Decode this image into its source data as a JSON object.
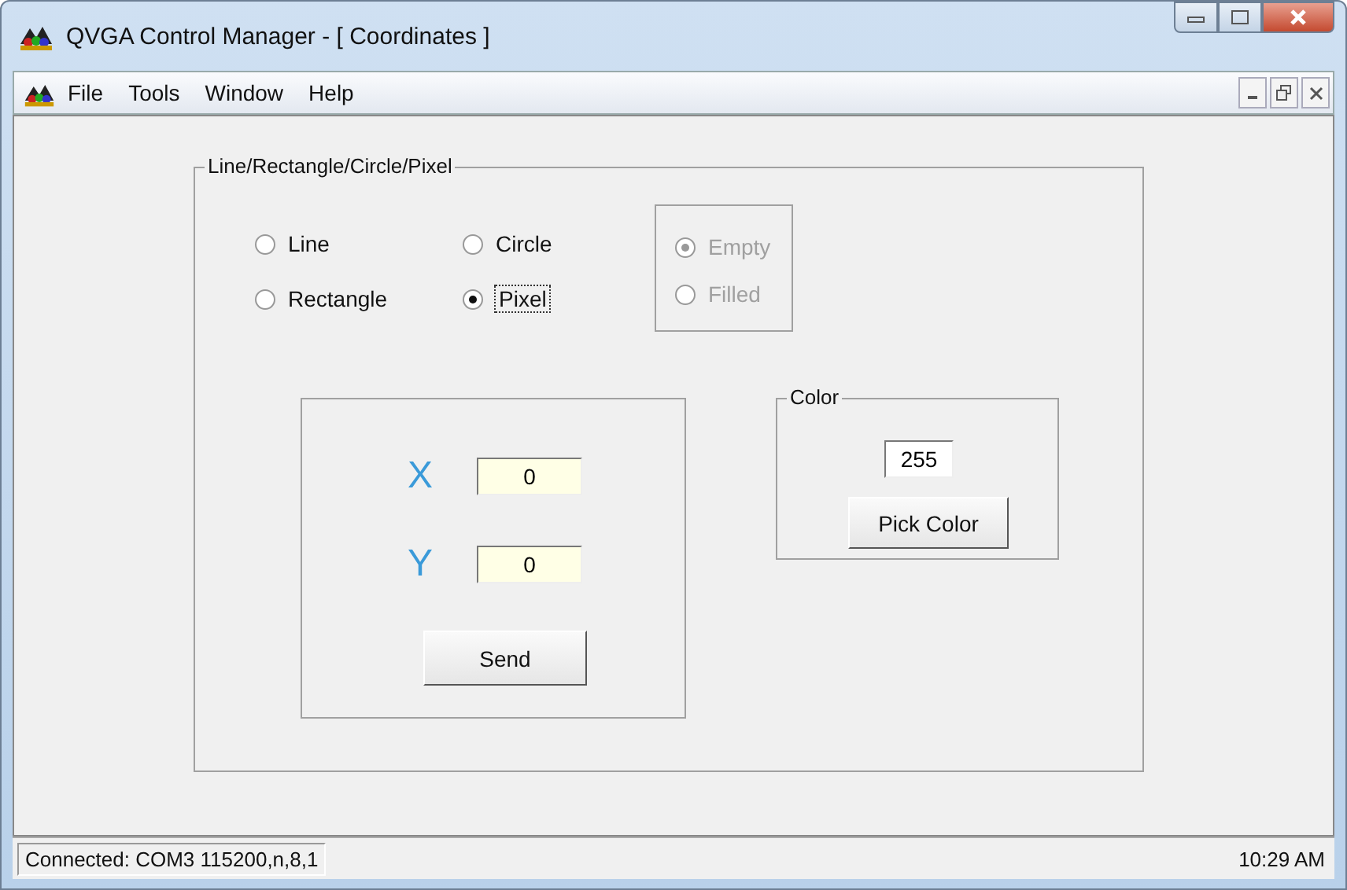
{
  "window": {
    "title": "QVGA Control Manager - [ Coordinates ]"
  },
  "menu": [
    "File",
    "Tools",
    "Window",
    "Help"
  ],
  "shape_group": {
    "title": "Line/Rectangle/Circle/Pixel",
    "options": [
      {
        "label": "Line",
        "selected": false
      },
      {
        "label": "Circle",
        "selected": false
      },
      {
        "label": "Rectangle",
        "selected": false
      },
      {
        "label": "Pixel",
        "selected": true
      }
    ]
  },
  "fill_group": {
    "disabled": true,
    "options": [
      {
        "label": "Empty",
        "selected": true
      },
      {
        "label": "Filled",
        "selected": false
      }
    ]
  },
  "coordinates": [
    {
      "label": "X",
      "value": "0"
    },
    {
      "label": "Y",
      "value": "0"
    }
  ],
  "send_button": "Send",
  "color_group": {
    "title": "Color",
    "value": "255",
    "button": "Pick Color"
  },
  "status_bar": {
    "connection": "Connected: COM3 115200,n,8,1",
    "time": "10:29 AM"
  }
}
